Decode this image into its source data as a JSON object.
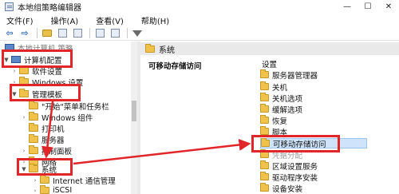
{
  "window": {
    "title": "本地组策略编辑器",
    "controls": {
      "minimize": "—",
      "maximize": "☐",
      "close": "✕"
    }
  },
  "menu": [
    "文件(F)",
    "操作(A)",
    "查看(V)",
    "帮助(H)"
  ],
  "toolbar": {
    "back_icon": "arrow-left-icon",
    "forward_icon": "arrow-right-icon",
    "back": "⇦",
    "forward": "⇨"
  },
  "tree": {
    "top_partial": "本地计算机 策略",
    "computer_config": "计算机配置",
    "software_settings": "软件设置",
    "windows_settings": "Windows 设置",
    "admin_templates": "管理模板",
    "start_menu": "\"开始\"菜单和任务栏",
    "windows_components": "Windows 组件",
    "printers": "打印机",
    "server": "服务器",
    "control_panel": "控制面板",
    "network": "网络",
    "system": "系统",
    "internet_comm": "Internet 通信管理",
    "iscsi": "iSCSI"
  },
  "right": {
    "header": "系统",
    "section_title": "可移动存储访问",
    "list_header": "设置",
    "items": [
      "服务器管理器",
      "关机",
      "关机选项",
      "缓解选项",
      "恢复",
      "脚本",
      "可移动存储访问",
      "区域设置服务",
      "驱动程序安装",
      "设备安装"
    ],
    "partial_items": [
      "凭据分配"
    ],
    "selected_index": 6
  },
  "annotation_color": "#e1262a"
}
